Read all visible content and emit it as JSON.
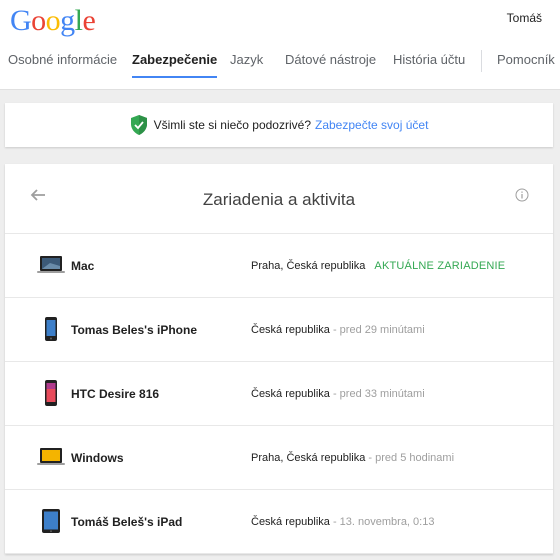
{
  "header": {
    "logo_letters": [
      {
        "char": "G",
        "color": "#4285f4"
      },
      {
        "char": "o",
        "color": "#ea4335"
      },
      {
        "char": "o",
        "color": "#fbbc05"
      },
      {
        "char": "g",
        "color": "#4285f4"
      },
      {
        "char": "l",
        "color": "#34a853"
      },
      {
        "char": "e",
        "color": "#ea4335"
      }
    ],
    "user_name": "Tomáš"
  },
  "tabs": [
    {
      "label": "Osobné informácie"
    },
    {
      "label": "Zabezpečenie",
      "active": true
    },
    {
      "label": "Jazyk"
    },
    {
      "label": "Dátové nástroje"
    },
    {
      "label": "História účtu"
    },
    {
      "label": "Pomocník"
    }
  ],
  "notice": {
    "icon": "shield-check-icon",
    "text": "Všimli ste si niečo podozrivé?",
    "link": "Zabezpečte svoj účet"
  },
  "card": {
    "title": "Zariadenia a aktivita",
    "back_icon": "arrow-left-icon",
    "info_icon": "info-icon"
  },
  "devices": [
    {
      "name": "Mac",
      "icon": "laptop-icon",
      "location": "Praha, Česká republika",
      "time": "",
      "current_label": "AKTUÁLNE ZARIADENIE"
    },
    {
      "name": "Tomas Beles's iPhone",
      "icon": "iphone-icon",
      "location": "Česká republika",
      "time": "pred 29 minútami"
    },
    {
      "name": "HTC Desire 816",
      "icon": "android-phone-icon",
      "location": "Česká republika",
      "time": "pred 33 minútami"
    },
    {
      "name": "Windows",
      "icon": "windows-laptop-icon",
      "location": "Praha, Česká republika",
      "time": "pred 5 hodinami"
    },
    {
      "name": "Tomáš Beleš's iPad",
      "icon": "ipad-icon",
      "location": "Česká republika",
      "time": "13. novembra, 0:13"
    }
  ],
  "colors": {
    "accent": "#4285f4",
    "current_device": "#34a853",
    "shield": "#34a853"
  }
}
